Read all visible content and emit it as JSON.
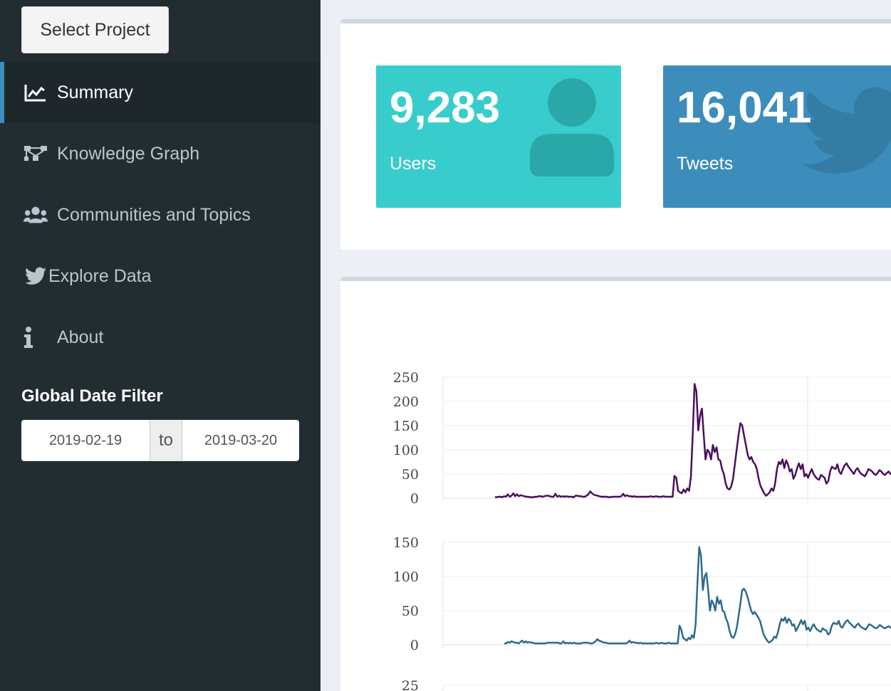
{
  "sidebar": {
    "select_project_label": "Select Project",
    "items": [
      {
        "label": "Summary",
        "icon": "line-chart-icon",
        "active": true
      },
      {
        "label": "Knowledge Graph",
        "icon": "graph-icon",
        "active": false
      },
      {
        "label": "Communities and Topics",
        "icon": "users-icon",
        "active": false
      },
      {
        "label": "Explore Data",
        "icon": "twitter-icon",
        "active": false
      },
      {
        "label": "About",
        "icon": "info-icon",
        "active": false
      }
    ],
    "date_filter": {
      "title": "Global Date Filter",
      "start": "2019-02-19",
      "separator": "to",
      "end": "2019-03-20"
    }
  },
  "value_boxes": [
    {
      "value": "9,283",
      "label": "Users",
      "icon": "user-icon",
      "color": "#39cccc"
    },
    {
      "value": "16,041",
      "label": "Tweets",
      "icon": "twitter-icon",
      "color": "#3c8dbc"
    }
  ],
  "colors": {
    "sidebar_bg": "#222d32",
    "active_item_bg": "#1e282c",
    "accent": "#3c8dbc",
    "series_1": "#4b0f5c",
    "series_2": "#2e6a8e"
  },
  "chart_data": [
    {
      "type": "line",
      "ylim": [
        0,
        250
      ],
      "yticks": [
        "250",
        "200",
        "150",
        "100",
        "50",
        "0"
      ],
      "series": [
        {
          "color": "#4b0f5c",
          "x": [
            0,
            1,
            2,
            3,
            4,
            5,
            6,
            7,
            8,
            9,
            10,
            11,
            12,
            13,
            14,
            15,
            16,
            17,
            18,
            19,
            20,
            21,
            22,
            23,
            24,
            25,
            26,
            27,
            28,
            29,
            30,
            31,
            32,
            33,
            34,
            35,
            36,
            37,
            38,
            39,
            40,
            41,
            42,
            43,
            44,
            45,
            46,
            47,
            48,
            49,
            50,
            51,
            52,
            53,
            54,
            55,
            56,
            57,
            58,
            59,
            60,
            61,
            62,
            63,
            64,
            65,
            66,
            67,
            68,
            69,
            70,
            71,
            72,
            73,
            74,
            75,
            76,
            77,
            78,
            79,
            80,
            81,
            82,
            83,
            84,
            85,
            86,
            87,
            88,
            89,
            90,
            91,
            92,
            93,
            94,
            95,
            96,
            97,
            98,
            99,
            100,
            101,
            102,
            103,
            104,
            105,
            106,
            107,
            108,
            109,
            110,
            111,
            112,
            113,
            114,
            115,
            116,
            117,
            118,
            119,
            120,
            121,
            122,
            123,
            124,
            125,
            126,
            127,
            128,
            129,
            130,
            131,
            132,
            133,
            134,
            135,
            136,
            137,
            138,
            139,
            140,
            141,
            142,
            143,
            144,
            145,
            146,
            147,
            148,
            149,
            150,
            151,
            152,
            153,
            154,
            155,
            156,
            157,
            158,
            159,
            160,
            161,
            162,
            163,
            164,
            165,
            166,
            167,
            168,
            169,
            170,
            171,
            172,
            173,
            174,
            175,
            176,
            177,
            178,
            179,
            180,
            181,
            182,
            183,
            184,
            185,
            186,
            187,
            188,
            189,
            190,
            191,
            192,
            193,
            194,
            195,
            196,
            197,
            198,
            199,
            200,
            201,
            202,
            203,
            204,
            205,
            206,
            207,
            208,
            209,
            210,
            211,
            212,
            213,
            214,
            215,
            216,
            217,
            218,
            219
          ],
          "values": [
            2,
            2,
            3,
            3,
            2,
            4,
            3,
            8,
            3,
            5,
            10,
            4,
            8,
            4,
            6,
            5,
            4,
            3,
            3,
            2,
            2,
            2,
            3,
            3,
            4,
            4,
            3,
            4,
            5,
            5,
            4,
            3,
            3,
            9,
            3,
            5,
            3,
            4,
            3,
            4,
            3,
            3,
            3,
            2,
            5,
            5,
            4,
            4,
            3,
            3,
            5,
            8,
            14,
            10,
            7,
            6,
            5,
            4,
            3,
            3,
            3,
            3,
            2,
            2,
            3,
            3,
            3,
            3,
            3,
            4,
            9,
            4,
            6,
            4,
            4,
            3,
            4,
            3,
            3,
            3,
            3,
            3,
            3,
            3,
            3,
            4,
            3,
            3,
            4,
            3,
            3,
            3,
            4,
            3,
            3,
            3,
            3,
            3,
            46,
            42,
            15,
            12,
            10,
            18,
            12,
            20,
            15,
            45,
            130,
            236,
            220,
            140,
            170,
            185,
            130,
            80,
            100,
            95,
            80,
            110,
            95,
            105,
            80,
            78,
            60,
            50,
            30,
            20,
            18,
            24,
            40,
            70,
            100,
            130,
            155,
            150,
            130,
            110,
            90,
            80,
            85,
            75,
            70,
            60,
            40,
            25,
            18,
            10,
            5,
            8,
            12,
            20,
            15,
            30,
            60,
            75,
            70,
            80,
            62,
            78,
            70,
            55,
            60,
            40,
            48,
            62,
            72,
            60,
            70,
            45,
            50,
            42,
            52,
            60,
            50,
            44,
            40,
            38,
            48,
            45,
            42,
            30,
            35,
            55,
            65,
            62,
            60,
            70,
            55,
            50,
            60,
            68,
            72,
            65,
            60,
            55,
            50,
            58,
            62,
            55,
            50,
            48,
            45,
            52,
            60,
            58,
            55,
            50,
            48,
            52,
            58,
            55,
            50,
            48,
            52,
            55,
            50,
            48,
            45,
            52
          ]
        }
      ]
    },
    {
      "type": "line",
      "ylim": [
        0,
        150
      ],
      "yticks": [
        "150",
        "100",
        "50",
        "0"
      ],
      "series": [
        {
          "color": "#2e6a8e",
          "x": [
            0,
            1,
            2,
            3,
            4,
            5,
            6,
            7,
            8,
            9,
            10,
            11,
            12,
            13,
            14,
            15,
            16,
            17,
            18,
            19,
            20,
            21,
            22,
            23,
            24,
            25,
            26,
            27,
            28,
            29,
            30,
            31,
            32,
            33,
            34,
            35,
            36,
            37,
            38,
            39,
            40,
            41,
            42,
            43,
            44,
            45,
            46,
            47,
            48,
            49,
            50,
            51,
            52,
            53,
            54,
            55,
            56,
            57,
            58,
            59,
            60,
            61,
            62,
            63,
            64,
            65,
            66,
            67,
            68,
            69,
            70,
            71,
            72,
            73,
            74,
            75,
            76,
            77,
            78,
            79,
            80,
            81,
            82,
            83,
            84,
            85,
            86,
            87,
            88,
            89,
            90,
            91,
            92,
            93,
            94,
            95,
            96,
            97,
            98,
            99,
            100,
            101,
            102,
            103,
            104,
            105,
            106,
            107,
            108,
            109,
            110,
            111,
            112,
            113,
            114,
            115,
            116,
            117,
            118,
            119,
            120,
            121,
            122,
            123,
            124,
            125,
            126,
            127,
            128,
            129,
            130,
            131,
            132,
            133,
            134,
            135,
            136,
            137,
            138,
            139,
            140,
            141,
            142,
            143,
            144,
            145,
            146,
            147,
            148,
            149,
            150,
            151,
            152,
            153,
            154,
            155,
            156,
            157,
            158,
            159,
            160,
            161,
            162,
            163,
            164,
            165,
            166,
            167,
            168,
            169,
            170,
            171,
            172,
            173,
            174,
            175,
            176,
            177,
            178,
            179,
            180,
            181,
            182,
            183,
            184,
            185,
            186,
            187,
            188,
            189,
            190,
            191,
            192,
            193,
            194,
            195,
            196,
            197,
            198,
            199,
            200,
            201,
            202,
            203,
            204,
            205,
            206,
            207,
            208,
            209,
            210,
            211,
            212,
            213,
            214,
            215,
            216,
            217,
            218,
            219
          ],
          "values": [
            2,
            2,
            4,
            3,
            5,
            4,
            3,
            3,
            2,
            4,
            6,
            3,
            5,
            3,
            4,
            3,
            3,
            2,
            2,
            2,
            2,
            2,
            2,
            2,
            3,
            3,
            3,
            3,
            3,
            3,
            3,
            2,
            2,
            5,
            2,
            3,
            2,
            3,
            2,
            3,
            2,
            2,
            2,
            2,
            3,
            3,
            3,
            3,
            2,
            2,
            3,
            5,
            8,
            6,
            5,
            4,
            3,
            3,
            2,
            2,
            2,
            2,
            2,
            2,
            2,
            2,
            2,
            2,
            2,
            3,
            6,
            3,
            4,
            3,
            3,
            2,
            3,
            2,
            2,
            2,
            2,
            2,
            2,
            2,
            2,
            3,
            2,
            2,
            3,
            2,
            2,
            2,
            3,
            2,
            2,
            2,
            2,
            2,
            28,
            22,
            10,
            8,
            6,
            10,
            8,
            14,
            10,
            30,
            90,
            143,
            130,
            80,
            100,
            105,
            80,
            50,
            65,
            60,
            50,
            70,
            60,
            65,
            50,
            48,
            38,
            32,
            20,
            12,
            10,
            15,
            25,
            42,
            60,
            80,
            82,
            78,
            70,
            60,
            50,
            45,
            48,
            44,
            40,
            35,
            25,
            15,
            10,
            6,
            3,
            5,
            7,
            12,
            10,
            18,
            30,
            38,
            35,
            40,
            32,
            38,
            35,
            28,
            30,
            20,
            25,
            30,
            36,
            30,
            35,
            22,
            25,
            20,
            26,
            30,
            25,
            22,
            20,
            19,
            24,
            22,
            21,
            15,
            17,
            27,
            32,
            31,
            30,
            35,
            27,
            25,
            30,
            34,
            36,
            32,
            30,
            27,
            25,
            29,
            31,
            27,
            25,
            24,
            22,
            26,
            30,
            29,
            27,
            25,
            24,
            26,
            29,
            27,
            25,
            24,
            26,
            27,
            25,
            24,
            22,
            26
          ]
        }
      ]
    },
    {
      "type": "line",
      "ylim": [
        0,
        25
      ],
      "yticks": [
        "25"
      ],
      "series": []
    }
  ]
}
